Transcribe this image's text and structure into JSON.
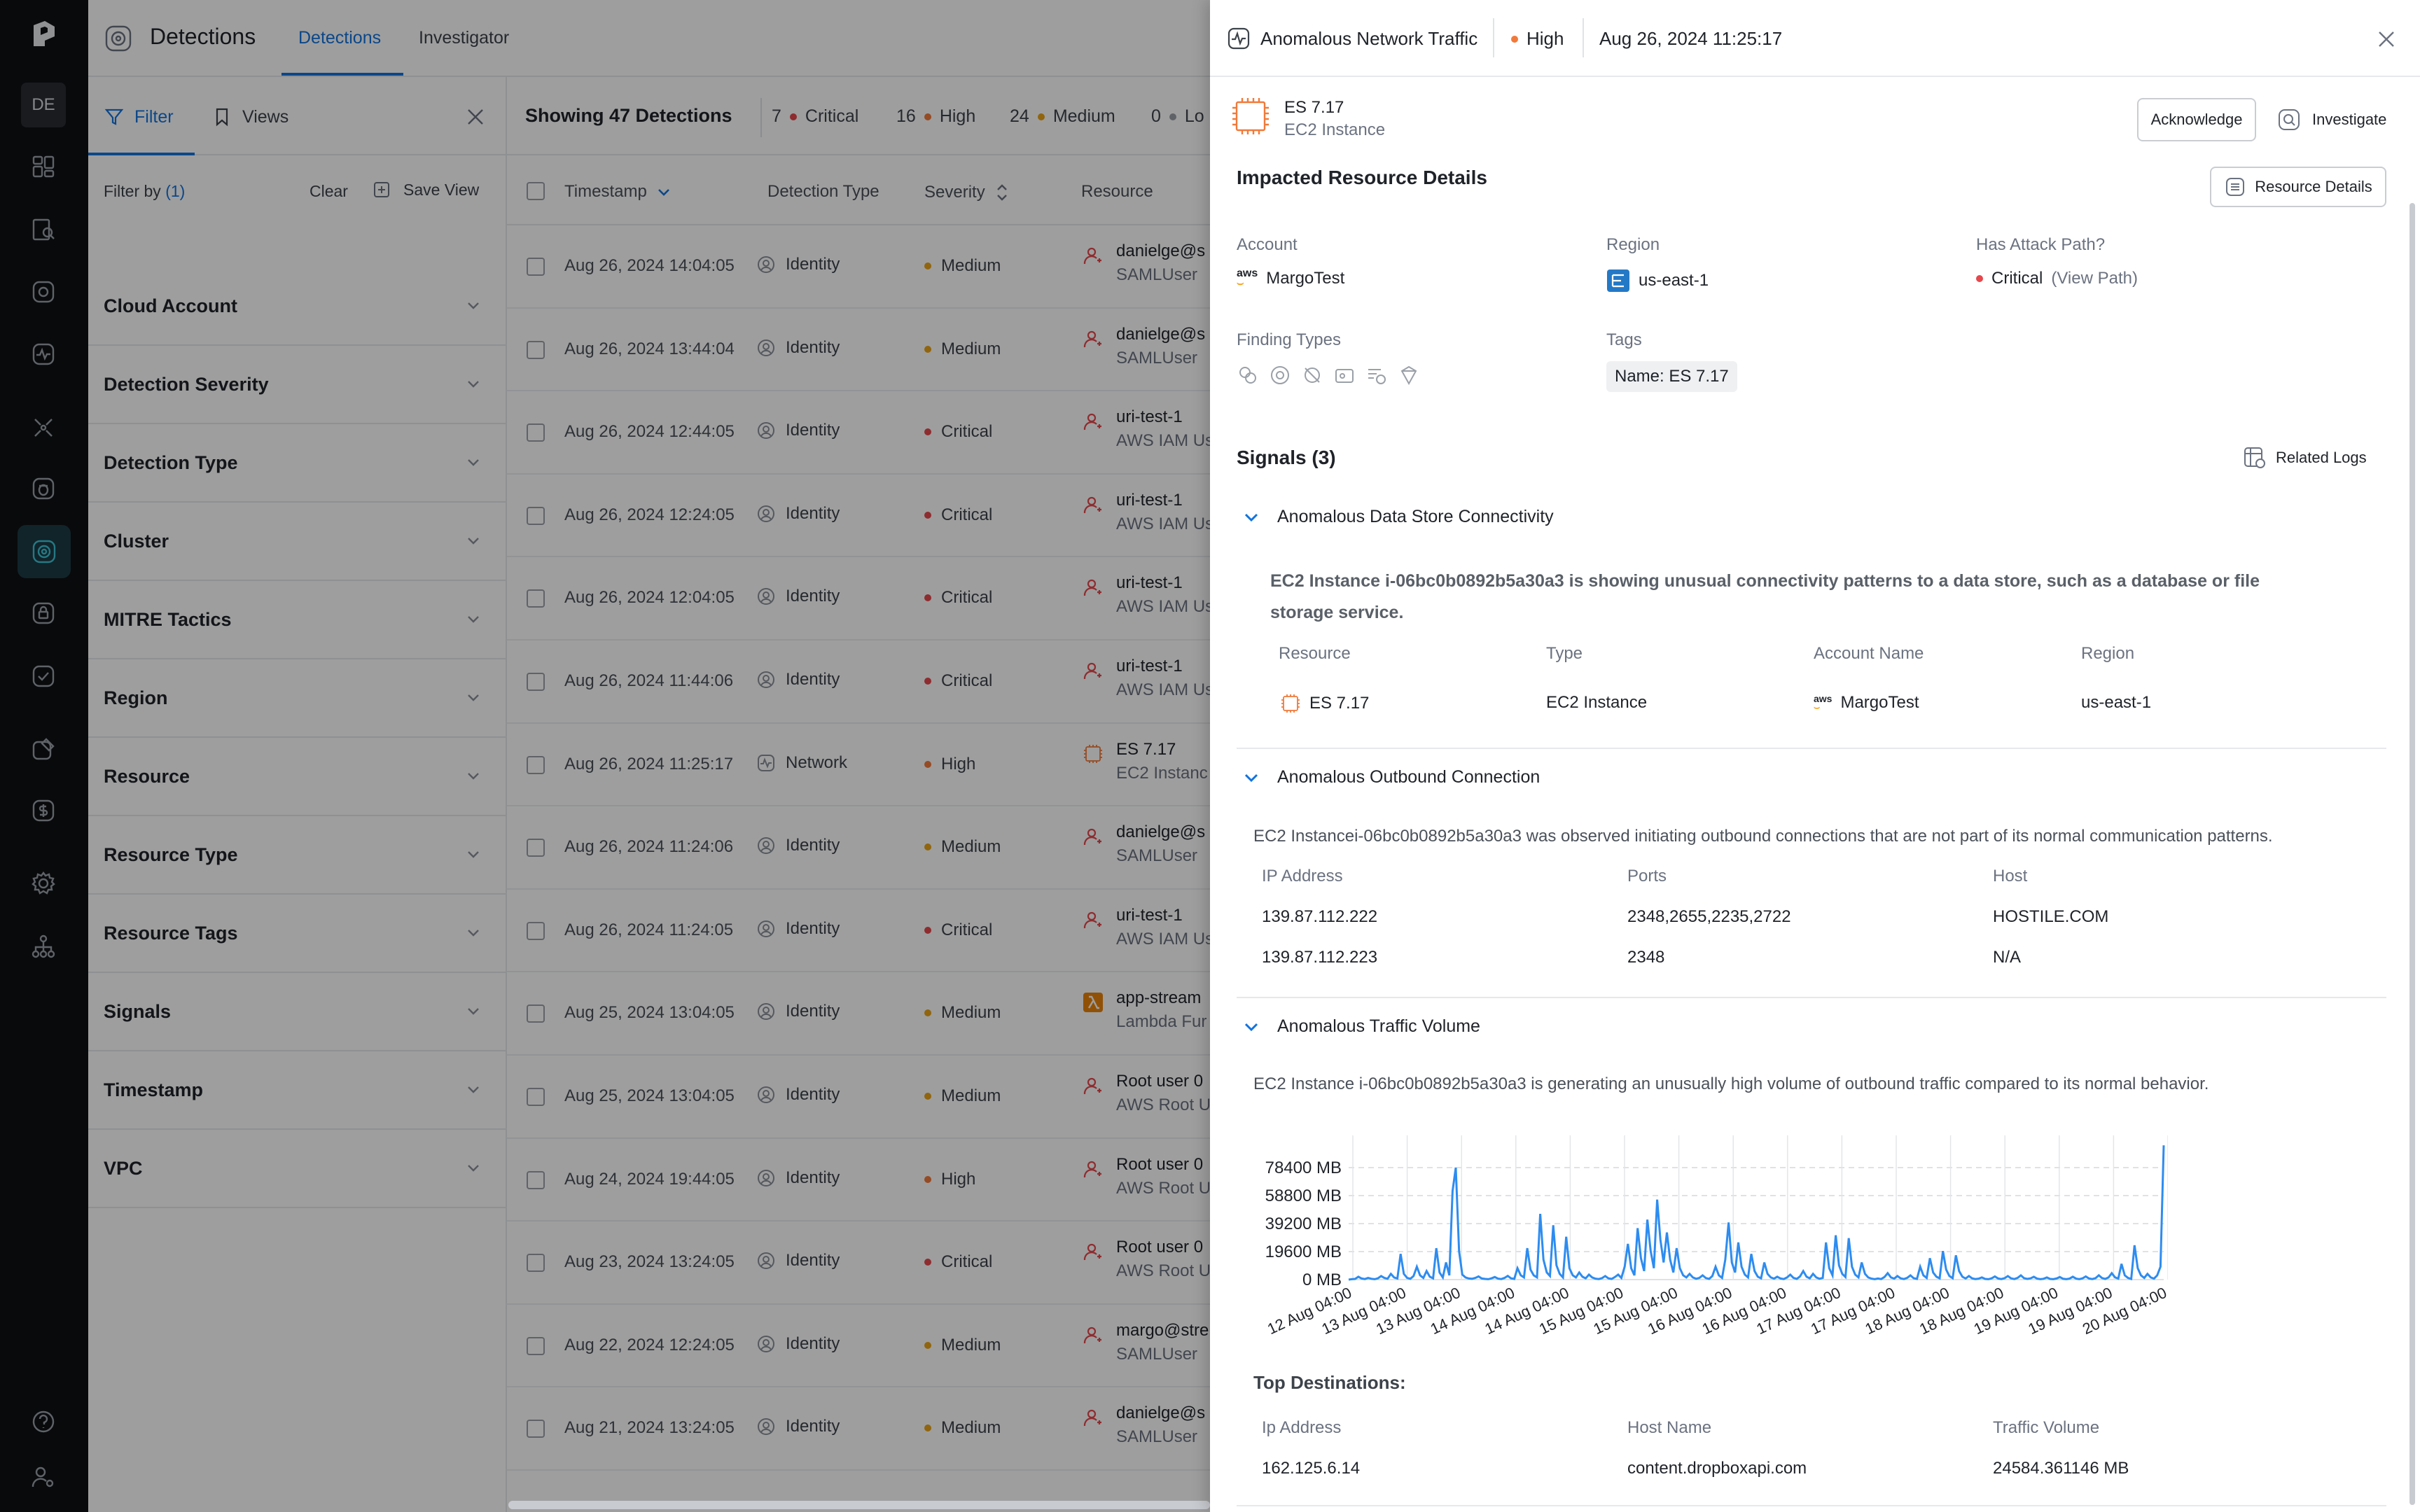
{
  "rail": {
    "avatar": "DE",
    "icons": [
      "logo-icon",
      "dashboard-icon",
      "search-book-icon",
      "target-icon",
      "pulse-icon",
      "crosshair-icon",
      "bug-icon",
      "detections-icon",
      "lock-icon",
      "check-shield-icon",
      "tool-icon",
      "cost-icon",
      "settings-icon",
      "org-icon",
      "help-icon",
      "user-settings-icon"
    ]
  },
  "topbar": {
    "title": "Detections",
    "tabs": [
      "Detections",
      "Investigator"
    ]
  },
  "filter_pane": {
    "tab_filter": "Filter",
    "tab_views": "Views",
    "filter_by": "Filter by",
    "filter_count": "(1)",
    "clear": "Clear",
    "save_view": "Save View",
    "groups": [
      "Cloud Account",
      "Detection Severity",
      "Detection Type",
      "Cluster",
      "MITRE Tactics",
      "Region",
      "Resource",
      "Resource Type",
      "Resource Tags",
      "Signals",
      "Timestamp",
      "VPC"
    ]
  },
  "list": {
    "showing": "Showing 47 Detections",
    "stats": [
      {
        "count": "7",
        "label": "Critical",
        "color": "#e5484d"
      },
      {
        "count": "16",
        "label": "High",
        "color": "#f17a3a"
      },
      {
        "count": "24",
        "label": "Medium",
        "color": "#e8a317"
      },
      {
        "count": "0",
        "label": "Lo",
        "color": "#9aa0a8"
      }
    ],
    "columns": [
      "Timestamp",
      "Detection Type",
      "Severity",
      "Resource"
    ],
    "rows": [
      {
        "ts": "Aug 26, 2024 14:04:05",
        "type": "Identity",
        "sev": "Medium",
        "res": "danielge@s",
        "sub": "SAMLUser",
        "icon": "user"
      },
      {
        "ts": "Aug 26, 2024 13:44:04",
        "type": "Identity",
        "sev": "Medium",
        "res": "danielge@s",
        "sub": "SAMLUser",
        "icon": "user"
      },
      {
        "ts": "Aug 26, 2024 12:44:05",
        "type": "Identity",
        "sev": "Critical",
        "res": "uri-test-1",
        "sub": "AWS IAM Us",
        "icon": "user"
      },
      {
        "ts": "Aug 26, 2024 12:24:05",
        "type": "Identity",
        "sev": "Critical",
        "res": "uri-test-1",
        "sub": "AWS IAM Us",
        "icon": "user"
      },
      {
        "ts": "Aug 26, 2024 12:04:05",
        "type": "Identity",
        "sev": "Critical",
        "res": "uri-test-1",
        "sub": "AWS IAM Us",
        "icon": "user"
      },
      {
        "ts": "Aug 26, 2024 11:44:06",
        "type": "Identity",
        "sev": "Critical",
        "res": "uri-test-1",
        "sub": "AWS IAM Us",
        "icon": "user"
      },
      {
        "ts": "Aug 26, 2024 11:25:17",
        "type": "Network",
        "sev": "High",
        "res": "ES 7.17",
        "sub": "EC2 Instanc",
        "icon": "chip"
      },
      {
        "ts": "Aug 26, 2024 11:24:06",
        "type": "Identity",
        "sev": "Medium",
        "res": "danielge@s",
        "sub": "SAMLUser",
        "icon": "user"
      },
      {
        "ts": "Aug 26, 2024 11:24:05",
        "type": "Identity",
        "sev": "Critical",
        "res": "uri-test-1",
        "sub": "AWS IAM Us",
        "icon": "user"
      },
      {
        "ts": "Aug 25, 2024 13:04:05",
        "type": "Identity",
        "sev": "Medium",
        "res": "app-stream",
        "sub": "Lambda Fur",
        "icon": "lambda"
      },
      {
        "ts": "Aug 25, 2024 13:04:05",
        "type": "Identity",
        "sev": "Medium",
        "res": "Root user 0",
        "sub": "AWS Root U",
        "icon": "user"
      },
      {
        "ts": "Aug 24, 2024 19:44:05",
        "type": "Identity",
        "sev": "High",
        "res": "Root user 0",
        "sub": "AWS Root U",
        "icon": "user"
      },
      {
        "ts": "Aug 23, 2024 13:24:05",
        "type": "Identity",
        "sev": "Critical",
        "res": "Root user 0",
        "sub": "AWS Root U",
        "icon": "user"
      },
      {
        "ts": "Aug 22, 2024 12:24:05",
        "type": "Identity",
        "sev": "Medium",
        "res": "margo@stre",
        "sub": "SAMLUser",
        "icon": "user"
      },
      {
        "ts": "Aug 21, 2024 13:24:05",
        "type": "Identity",
        "sev": "Medium",
        "res": "danielge@s",
        "sub": "SAMLUser",
        "icon": "user"
      }
    ],
    "severity_colors": {
      "Critical": "#e5484d",
      "High": "#f17a3a",
      "Medium": "#e8a317"
    }
  },
  "drawer": {
    "title": "Anomalous Network Traffic",
    "severity": "High",
    "severity_color": "#f17a3a",
    "timestamp": "Aug 26, 2024 11:25:17",
    "resource_name": "ES 7.17",
    "resource_type": "EC2 Instance",
    "acknowledge": "Acknowledge",
    "investigate": "Investigate",
    "impacted_title": "Impacted Resource Details",
    "resource_details_btn": "Resource Details",
    "account_label": "Account",
    "account_value": "MargoTest",
    "aws_text": "aws",
    "region_label": "Region",
    "region_value": "us-east-1",
    "attack_label": "Has Attack Path?",
    "attack_value": "Critical",
    "attack_link": "(View Path)",
    "finding_label": "Finding Types",
    "tags_label": "Tags",
    "tag_value": "Name: ES 7.17",
    "signals_title": "Signals (3)",
    "related_logs": "Related Logs",
    "signal1": {
      "title": "Anomalous Data Store Connectivity",
      "desc_line1": "EC2 Instance i-06bc0b0892b5a30a3 is showing unusual connectivity patterns to a data store, such as a database or file",
      "desc_line2": "storage service.",
      "headers": [
        "Resource",
        "Type",
        "Account Name",
        "Region"
      ],
      "row": [
        "ES 7.17",
        "EC2 Instance",
        "MargoTest",
        "us-east-1"
      ]
    },
    "signal2": {
      "title": "Anomalous Outbound Connection",
      "desc": "EC2 Instancei-06bc0b0892b5a30a3 was observed initiating outbound connections that are not part of its normal communication patterns.",
      "headers": [
        "IP Address",
        "Ports",
        "Host"
      ],
      "rows": [
        [
          "139.87.112.222",
          "2348,2655,2235,2722",
          "HOSTILE.COM"
        ],
        [
          "139.87.112.223",
          "2348",
          "N/A"
        ]
      ]
    },
    "signal3": {
      "title": "Anomalous Traffic Volume",
      "desc": "EC2 Instance i-06bc0b0892b5a30a3 is generating an unusually high volume of outbound traffic compared to its normal behavior.",
      "top_dest_title": "Top Destinations:",
      "headers": [
        "Ip Address",
        "Host Name",
        "Traffic Volume"
      ],
      "rows": [
        [
          "162.125.6.14",
          "content.dropboxapi.com",
          "24584.361146 MB"
        ]
      ]
    }
  },
  "chart_data": {
    "type": "line",
    "y_ticks": [
      "0 MB",
      "19600 MB",
      "39200 MB",
      "58800 MB",
      "78400 MB"
    ],
    "y_tick_values": [
      0,
      19600,
      39200,
      58800,
      78400
    ],
    "ylim": [
      0,
      98000
    ],
    "x_ticks": [
      "12 Aug 04:00",
      "13 Aug 04:00",
      "13 Aug 04:00",
      "14 Aug 04:00",
      "14 Aug 04:00",
      "15 Aug 04:00",
      "15 Aug 04:00",
      "16 Aug 04:00",
      "16 Aug 04:00",
      "17 Aug 04:00",
      "17 Aug 04:00",
      "18 Aug 04:00",
      "18 Aug 04:00",
      "19 Aug 04:00",
      "19 Aug 04:00",
      "20 Aug 04:00"
    ],
    "grid": true,
    "color": "#2d8cf0",
    "values": [
      0,
      300,
      500,
      2000,
      800,
      400,
      1200,
      600,
      300,
      900,
      2500,
      1200,
      600,
      4000,
      1500,
      800,
      18000,
      4000,
      1200,
      600,
      2500,
      9000,
      3000,
      1200,
      6000,
      2000,
      900,
      22000,
      5000,
      1500,
      12000,
      3000,
      62000,
      78400,
      20000,
      3500,
      1500,
      800,
      600,
      1200,
      2200,
      800,
      500,
      300,
      900,
      1800,
      700,
      400,
      1200,
      2600,
      900,
      500,
      8000,
      3000,
      1500,
      22000,
      7000,
      3000,
      1500,
      46000,
      14000,
      5000,
      2500,
      38000,
      10000,
      4000,
      1500,
      30000,
      8000,
      3000,
      1500,
      5000,
      2000,
      900,
      3500,
      1500,
      700,
      400,
      1000,
      2500,
      900,
      500,
      1800,
      3500,
      1200,
      9000,
      25000,
      8000,
      3000,
      36000,
      15000,
      6000,
      42000,
      20000,
      8000,
      56000,
      28000,
      12000,
      33000,
      14000,
      5000,
      22000,
      8000,
      3000,
      1500,
      4000,
      1500,
      600,
      1200,
      3000,
      1100,
      500,
      2500,
      9000,
      3000,
      1200,
      14000,
      40000,
      12000,
      5000,
      26000,
      9000,
      3500,
      1500,
      18000,
      6000,
      2000,
      900,
      12000,
      4000,
      1500,
      700,
      2000,
      800,
      400,
      1500,
      3500,
      1200,
      500,
      2200,
      6000,
      2000,
      900,
      4000,
      1500,
      600,
      1200,
      26000,
      8000,
      3000,
      31000,
      10000,
      4000,
      1800,
      29000,
      9000,
      3500,
      1500,
      12000,
      4000,
      1500,
      700,
      300,
      800,
      400,
      1800,
      4500,
      1500,
      700,
      2500,
      900,
      400,
      1200,
      3000,
      1000,
      500,
      9000,
      3000,
      1200,
      15000,
      5000,
      2000,
      900,
      20000,
      7000,
      2500,
      1000,
      17000,
      6000,
      2000,
      800,
      2500,
      900,
      400,
      700,
      1500,
      500,
      300,
      900,
      2200,
      800,
      400,
      1000,
      2500,
      900,
      400,
      1200,
      3000,
      1000,
      500,
      900,
      2000,
      700,
      300,
      600,
      1500,
      500,
      300,
      800,
      1800,
      600,
      300,
      700,
      2000,
      700,
      350,
      900,
      2200,
      800,
      400,
      1000,
      3000,
      1100,
      500,
      1500,
      4500,
      1600,
      700,
      11000,
      3000,
      1200,
      500,
      24000,
      8000,
      3000,
      1200,
      4000,
      1500,
      700,
      3000,
      9000,
      94000
    ]
  }
}
